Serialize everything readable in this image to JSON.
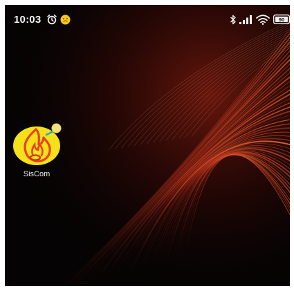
{
  "status_bar": {
    "time": "10:03",
    "battery_level": "90",
    "icons": [
      "alarm-clock-icon",
      "notification-emoji-icon",
      "bluetooth-icon",
      "cellular-signal-icon",
      "wifi-icon",
      "battery-icon"
    ]
  },
  "home_screen": {
    "apps": [
      {
        "label": "SisCom",
        "icon": "siscom-flame-icon",
        "has_notification_dot": true
      }
    ]
  },
  "colors": {
    "wallpaper_base": "#050303",
    "wallpaper_streaks": "#c8331c",
    "app_icon_background": "#f5e11a",
    "app_icon_flame": "#e8421e",
    "notification_dot": "#f3e27a"
  }
}
